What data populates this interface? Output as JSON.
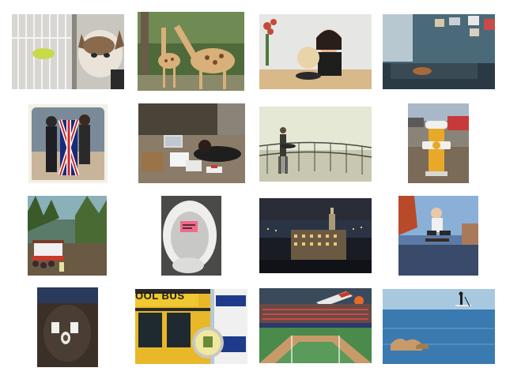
{
  "gallery": {
    "images": [
      {
        "subject": "kitten-and-bird-cage"
      },
      {
        "subject": "giraffes"
      },
      {
        "subject": "woman-with-dog"
      },
      {
        "subject": "bedroom-with-guitar"
      },
      {
        "subject": "couple-with-flag"
      },
      {
        "subject": "woman-on-floor-with-laptop"
      },
      {
        "subject": "skateboarder-by-railing"
      },
      {
        "subject": "fire-hydrant"
      },
      {
        "subject": "trolley-in-forest"
      },
      {
        "subject": "toilet-with-note"
      },
      {
        "subject": "city-night-skyline"
      },
      {
        "subject": "skateboard-jump"
      },
      {
        "subject": "toilet-pad-on-floor"
      },
      {
        "subject": "school-bus"
      },
      {
        "subject": "baseball-stadium"
      },
      {
        "subject": "paddleboarder-on-water"
      }
    ]
  },
  "signs": {
    "school_bus": "OOL BUS"
  },
  "colors": {
    "background": "#ffffff"
  }
}
